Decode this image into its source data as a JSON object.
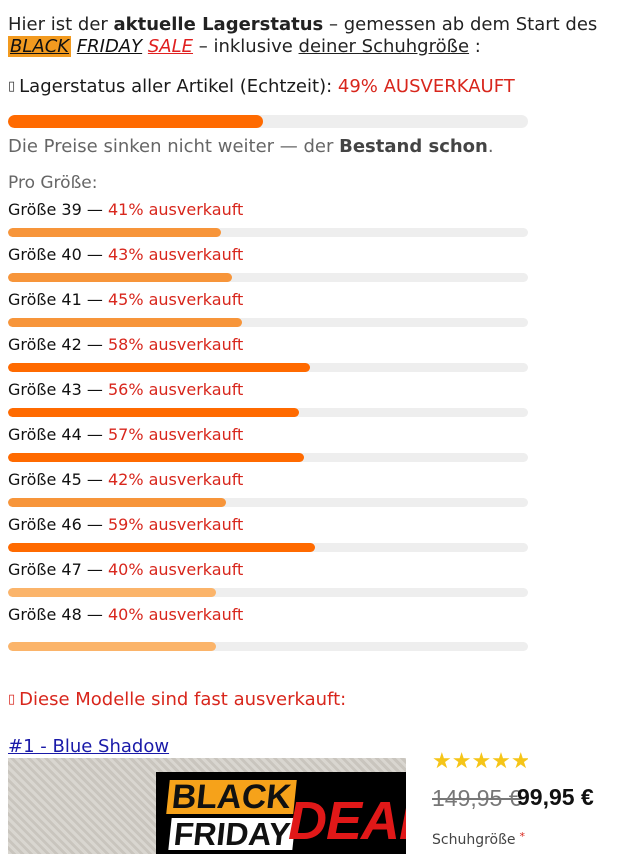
{
  "intro": {
    "t1": "Hier ist der ",
    "b1": "aktuelle Lagerstatus",
    "t2": " – gemessen ab dem Start des",
    "bf_black": "BLACK",
    "bf_friday": "FRIDAY",
    "bf_sale": "SALE",
    "t3": " – inklusive ",
    "u1": "deiner Schuhgröße",
    "t4": " :"
  },
  "status": {
    "glyph": "▯",
    "label": "Lagerstatus aller Artikel (Echtzeit): ",
    "value": "49% AUSVERKAUFT",
    "percent": 49,
    "color": "#ff6a00"
  },
  "info": {
    "t1": "Die Preise sinken nicht weiter — der ",
    "b1": "Bestand schon",
    "t2": "."
  },
  "per_size_heading": "Pro Größe:",
  "sizes": [
    {
      "size": "Größe 39",
      "sep": " — ",
      "label": "41% ausverkauft",
      "percent": 41,
      "color": "#f7953a"
    },
    {
      "size": "Größe 40",
      "sep": " — ",
      "label": "43% ausverkauft",
      "percent": 43,
      "color": "#f7953a"
    },
    {
      "size": "Größe 41",
      "sep": " — ",
      "label": "45% ausverkauft",
      "percent": 45,
      "color": "#f7953a"
    },
    {
      "size": "Größe 42",
      "sep": " — ",
      "label": "58% ausverkauft",
      "percent": 58,
      "color": "#ff6a00"
    },
    {
      "size": "Größe 43",
      "sep": " — ",
      "label": "56% ausverkauft",
      "percent": 56,
      "color": "#ff6a00"
    },
    {
      "size": "Größe 44",
      "sep": " — ",
      "label": "57% ausverkauft",
      "percent": 57,
      "color": "#ff6a00"
    },
    {
      "size": "Größe 45",
      "sep": " — ",
      "label": "42% ausverkauft",
      "percent": 42,
      "color": "#f7953a"
    },
    {
      "size": "Größe 46",
      "sep": " — ",
      "label": "59% ausverkauft",
      "percent": 59,
      "color": "#ff6a00"
    },
    {
      "size": "Größe 47",
      "sep": " — ",
      "label": "40% ausverkauft",
      "percent": 40,
      "color": "#fbb46a"
    },
    {
      "size": "Größe 48",
      "sep": " — ",
      "label": "40% ausverkauft",
      "percent": 40,
      "color": "#fbb46a"
    }
  ],
  "almost_sold_out": {
    "glyph": "▯",
    "text": "Diese Modelle sind fast ausverkauft:"
  },
  "model": {
    "link": "#1 - Blue Shadow",
    "banner_black": "BLACK",
    "banner_friday": "FRIDAY",
    "banner_deal": "DEAL",
    "rating_stars": 4.5,
    "stars_glyphs": "★★★★★",
    "price_old": "149,95 €",
    "price_new": "99,95 €",
    "shoe_size_label": "Schuhgröße",
    "required_mark": "*"
  }
}
